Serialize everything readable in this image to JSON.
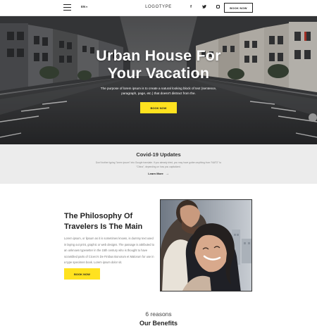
{
  "header": {
    "language": "EN",
    "logo": "LOGOTYPE",
    "social_icons": [
      "facebook-icon",
      "twitter-icon",
      "instagram-icon"
    ],
    "social_glyphs": {
      "facebook": "f",
      "twitter": "🐦"
    },
    "book_button": "BOOK NOW"
  },
  "hero": {
    "title_line1": "Urban House For",
    "title_line2": "Your Vacation",
    "subtitle": "The purpose of lorem ipsum is to create a natural looking block of text (sentence, paragraph, page, etc.) that doesn't distract from the.",
    "button": "BOOK NOW"
  },
  "covid": {
    "title": "Covid-19 Updates",
    "text": "Don't bother typing \"lorem ipsum\" into Google translate. If you already tried, you may have gotten anything from \"NATO\" to \"China\", depending on how you capitalized.",
    "link": "Learn More"
  },
  "philosophy": {
    "title_line1": "The Philosophy Of",
    "title_line2": "Travelers Is The Main",
    "text": "Lorem ipsum, or lipsum as it is sometimes known, is dummy text used in laying out print, graphic or web designs. The passage is attributed to an unknown typesetter in the 15th century who is thought to have scrambled parts of Cicero's De Finibus Bonorum et Malorum for use in a type specimen book. Lorem ipsum dolor sit.",
    "button": "BOOK NOW"
  },
  "benefits": {
    "count_label": "6 reasons",
    "title": "Our Benefits"
  },
  "colors": {
    "accent": "#ffe21f",
    "covid_bg": "#ececec",
    "text_dark": "#222222"
  }
}
